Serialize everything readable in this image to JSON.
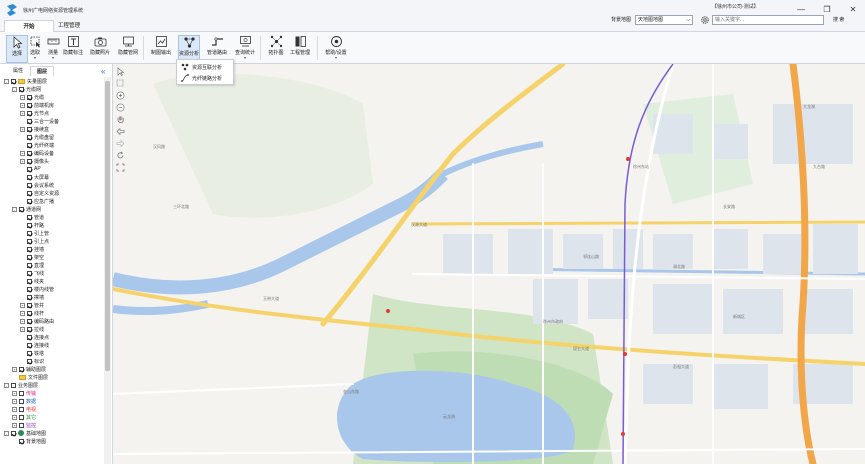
{
  "app": {
    "title": "徐州广电网络资源管理系统"
  },
  "tabs": [
    {
      "label": "开始"
    },
    {
      "label": "工程管理"
    }
  ],
  "user": {
    "info": "【徐州市公司-测试】"
  },
  "basemap": {
    "label": "背景地图",
    "value": "天地图地图"
  },
  "search": {
    "placeholder": "输入关键字...",
    "button": "搜 索"
  },
  "toolbar": [
    {
      "label": "选择"
    },
    {
      "label": "选取"
    },
    {
      "label": "测量"
    },
    {
      "label": "隐藏标注"
    },
    {
      "label": "隐藏照片"
    },
    {
      "label": "隐藏管网"
    },
    {
      "label": "制图输出"
    },
    {
      "label": "资源分析"
    },
    {
      "label": "管道路由"
    },
    {
      "label": "查询统计"
    },
    {
      "label": "拓扑图"
    },
    {
      "label": "工程管理"
    },
    {
      "label": "帮助/设置"
    }
  ],
  "popup": [
    {
      "label": "资源互联分析"
    },
    {
      "label": "光纤链路分析"
    }
  ],
  "panel": {
    "tab_attr": "属性",
    "tab_layer": "图层"
  },
  "tree": [
    {
      "label": "矢量图层",
      "depth": 0,
      "exp": "-",
      "kind": "folder",
      "checked": true
    },
    {
      "label": "光缆网",
      "depth": 1,
      "exp": "-",
      "kind": "cb",
      "checked": true
    },
    {
      "label": "光缆",
      "depth": 2,
      "exp": "+",
      "kind": "cb",
      "checked": true
    },
    {
      "label": "前端机房",
      "depth": 2,
      "exp": "+",
      "kind": "cb",
      "checked": true
    },
    {
      "label": "光节点",
      "depth": 2,
      "exp": "+",
      "kind": "cb",
      "checked": true
    },
    {
      "label": "三合一设备",
      "depth": 2,
      "exp": "",
      "kind": "cb",
      "checked": true
    },
    {
      "label": "接续盒",
      "depth": 2,
      "exp": "+",
      "kind": "cb",
      "checked": true
    },
    {
      "label": "光缆盘留",
      "depth": 2,
      "exp": "",
      "kind": "cb",
      "checked": true
    },
    {
      "label": "光纤终端",
      "depth": 2,
      "exp": "",
      "kind": "cb",
      "checked": true
    },
    {
      "label": "编码设备",
      "depth": 2,
      "exp": "+",
      "kind": "cb",
      "checked": true
    },
    {
      "label": "摄像头",
      "depth": 2,
      "exp": "+",
      "kind": "cb",
      "checked": true
    },
    {
      "label": "AP",
      "depth": 2,
      "exp": "",
      "kind": "cb",
      "checked": true
    },
    {
      "label": "大屏幕",
      "depth": 2,
      "exp": "",
      "kind": "cb",
      "checked": true
    },
    {
      "label": "会议系统",
      "depth": 2,
      "exp": "",
      "kind": "cb",
      "checked": true
    },
    {
      "label": "自定义资源",
      "depth": 2,
      "exp": "",
      "kind": "cb",
      "checked": true
    },
    {
      "label": "应急广播",
      "depth": 2,
      "exp": "",
      "kind": "cb",
      "checked": true
    },
    {
      "label": "通道网",
      "depth": 1,
      "exp": "-",
      "kind": "cb",
      "checked": true
    },
    {
      "label": "管道",
      "depth": 2,
      "exp": "",
      "kind": "cb",
      "checked": true
    },
    {
      "label": "杆路",
      "depth": 2,
      "exp": "",
      "kind": "cb",
      "checked": true
    },
    {
      "label": "引上管",
      "depth": 2,
      "exp": "",
      "kind": "cb",
      "checked": true
    },
    {
      "label": "引上点",
      "depth": 2,
      "exp": "",
      "kind": "cb",
      "checked": true
    },
    {
      "label": "挂墙",
      "depth": 2,
      "exp": "",
      "kind": "cb",
      "checked": true
    },
    {
      "label": "架空",
      "depth": 2,
      "exp": "",
      "kind": "cb",
      "checked": true
    },
    {
      "label": "直埋",
      "depth": 2,
      "exp": "",
      "kind": "cb",
      "checked": true
    },
    {
      "label": "飞线",
      "depth": 2,
      "exp": "",
      "kind": "cb",
      "checked": true
    },
    {
      "label": "线夹",
      "depth": 2,
      "exp": "",
      "kind": "cb",
      "checked": true
    },
    {
      "label": "楼内线管",
      "depth": 2,
      "exp": "",
      "kind": "cb",
      "checked": true
    },
    {
      "label": "撑墙",
      "depth": 2,
      "exp": "",
      "kind": "cb",
      "checked": true
    },
    {
      "label": "管井",
      "depth": 2,
      "exp": "+",
      "kind": "cb",
      "checked": true
    },
    {
      "label": "线杆",
      "depth": 2,
      "exp": "+",
      "kind": "cb",
      "checked": true
    },
    {
      "label": "编码路由",
      "depth": 2,
      "exp": "+",
      "kind": "cb",
      "checked": true
    },
    {
      "label": "拉线",
      "depth": 2,
      "exp": "+",
      "kind": "cb",
      "checked": true
    },
    {
      "label": "连接点",
      "depth": 2,
      "exp": "",
      "kind": "cb",
      "checked": true
    },
    {
      "label": "连接线",
      "depth": 2,
      "exp": "",
      "kind": "cb",
      "checked": true
    },
    {
      "label": "铁塔",
      "depth": 2,
      "exp": "",
      "kind": "cb",
      "checked": true
    },
    {
      "label": "标识",
      "depth": 2,
      "exp": "",
      "kind": "cb",
      "checked": true
    },
    {
      "label": "辅助图层",
      "depth": 1,
      "exp": "+",
      "kind": "cb",
      "checked": true
    },
    {
      "label": "文件图层",
      "depth": 1,
      "exp": "",
      "kind": "folder",
      "checked": true
    },
    {
      "label": "业务图层",
      "depth": 0,
      "exp": "-",
      "kind": "cb",
      "checked": false
    },
    {
      "label": "传输",
      "depth": 1,
      "exp": "+",
      "kind": "cb",
      "checked": false,
      "color": "#e0218a"
    },
    {
      "label": "数据",
      "depth": 1,
      "exp": "+",
      "kind": "cb",
      "checked": false,
      "color": "#1f5fd6"
    },
    {
      "label": "电视",
      "depth": 1,
      "exp": "+",
      "kind": "cb",
      "checked": false,
      "color": "#e53935"
    },
    {
      "label": "其它",
      "depth": 1,
      "exp": "+",
      "kind": "cb",
      "checked": false,
      "color": "#2e9d3a"
    },
    {
      "label": "监控",
      "depth": 1,
      "exp": "+",
      "kind": "cb",
      "checked": false,
      "color": "#8e3ab5"
    },
    {
      "label": "基础地图",
      "depth": 0,
      "exp": "-",
      "kind": "globe",
      "checked": true
    },
    {
      "label": "背景地图",
      "depth": 1,
      "exp": "",
      "kind": "cb",
      "checked": true
    }
  ],
  "map": {
    "labels": [
      "三环北路",
      "汉源大道",
      "玉带大道",
      "昆仑大道",
      "九台路",
      "湖北路",
      "徐州市政府",
      "云龙湖",
      "徐州东站",
      "大龙湖",
      "新城区",
      "金山东路",
      "彭祖大道",
      "长安路",
      "祁连山路",
      "汉风路"
    ]
  }
}
